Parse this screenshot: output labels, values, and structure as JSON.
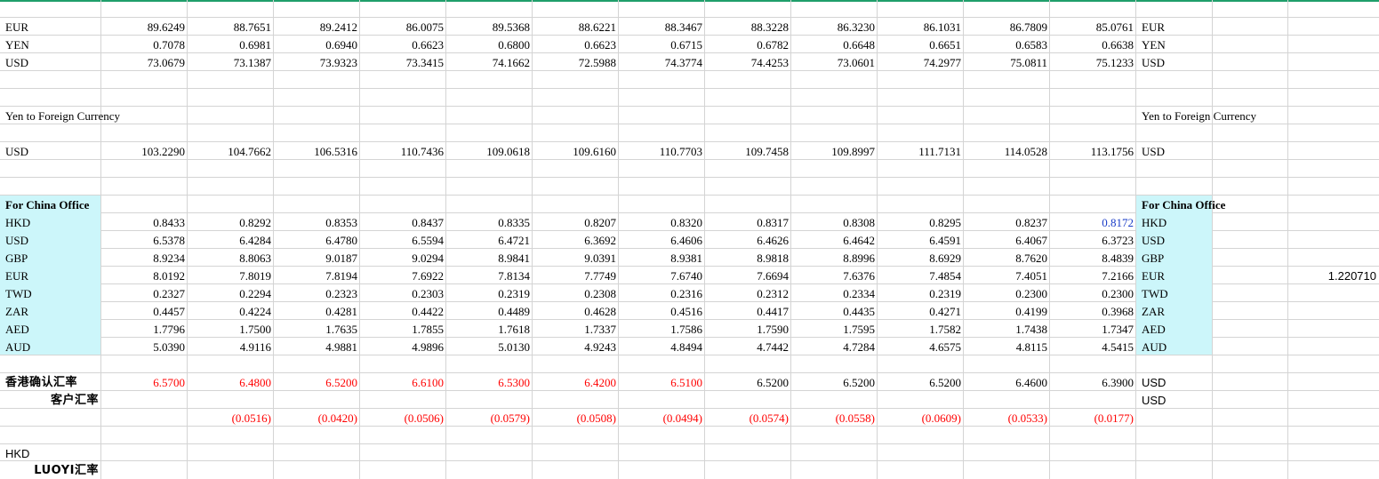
{
  "sheet": {
    "fx_section": {
      "rows": [
        {
          "label": "EUR",
          "values": [
            "89.6249",
            "88.7651",
            "89.2412",
            "86.0075",
            "89.5368",
            "88.6221",
            "88.3467",
            "88.3228",
            "86.3230",
            "86.1031",
            "86.7809",
            "85.0761"
          ],
          "right_label": "EUR"
        },
        {
          "label": "YEN",
          "values": [
            "0.7078",
            "0.6981",
            "0.6940",
            "0.6623",
            "0.6800",
            "0.6623",
            "0.6715",
            "0.6782",
            "0.6648",
            "0.6651",
            "0.6583",
            "0.6638"
          ],
          "right_label": "YEN"
        },
        {
          "label": "USD",
          "values": [
            "73.0679",
            "73.1387",
            "73.9323",
            "73.3415",
            "74.1662",
            "72.5988",
            "74.3774",
            "74.4253",
            "73.0601",
            "74.2977",
            "75.0811",
            "75.1233"
          ],
          "right_label": "USD"
        }
      ]
    },
    "yen_section": {
      "title": "Yen to Foreign Currency",
      "title_right": "Yen to Foreign Currency",
      "rows": [
        {
          "label": "USD",
          "values": [
            "103.2290",
            "104.7662",
            "106.5316",
            "110.7436",
            "109.0618",
            "109.6160",
            "110.7703",
            "109.7458",
            "109.8997",
            "111.7131",
            "114.0528",
            "113.1756"
          ],
          "right_label": "USD"
        }
      ]
    },
    "china_section": {
      "title": "For China Office",
      "title_right": "For China Office",
      "rows": [
        {
          "label": "HKD",
          "values": [
            "0.8433",
            "0.8292",
            "0.8353",
            "0.8437",
            "0.8335",
            "0.8207",
            "0.8320",
            "0.8317",
            "0.8308",
            "0.8295",
            "0.8237",
            "0.8172"
          ],
          "right_label": "HKD"
        },
        {
          "label": "USD",
          "values": [
            "6.5378",
            "6.4284",
            "6.4780",
            "6.5594",
            "6.4721",
            "6.3692",
            "6.4606",
            "6.4626",
            "6.4642",
            "6.4591",
            "6.4067",
            "6.3723"
          ],
          "right_label": "USD"
        },
        {
          "label": "GBP",
          "values": [
            "8.9234",
            "8.8063",
            "9.0187",
            "9.0294",
            "8.9841",
            "9.0391",
            "8.9381",
            "8.9818",
            "8.8996",
            "8.6929",
            "8.7620",
            "8.4839"
          ],
          "right_label": "GBP"
        },
        {
          "label": "EUR",
          "values": [
            "8.0192",
            "7.8019",
            "7.8194",
            "7.6922",
            "7.8134",
            "7.7749",
            "7.6740",
            "7.6694",
            "7.6376",
            "7.4854",
            "7.4051",
            "7.2166"
          ],
          "right_label": "EUR"
        },
        {
          "label": "TWD",
          "values": [
            "0.2327",
            "0.2294",
            "0.2323",
            "0.2303",
            "0.2319",
            "0.2308",
            "0.2316",
            "0.2312",
            "0.2334",
            "0.2319",
            "0.2300",
            "0.2300"
          ],
          "right_label": "TWD"
        },
        {
          "label": "ZAR",
          "values": [
            "0.4457",
            "0.4224",
            "0.4281",
            "0.4422",
            "0.4489",
            "0.4628",
            "0.4516",
            "0.4417",
            "0.4435",
            "0.4271",
            "0.4199",
            "0.3968"
          ],
          "right_label": "ZAR"
        },
        {
          "label": "AED",
          "values": [
            "1.7796",
            "1.7500",
            "1.7635",
            "1.7855",
            "1.7618",
            "1.7337",
            "1.7586",
            "1.7590",
            "1.7595",
            "1.7582",
            "1.7438",
            "1.7347"
          ],
          "right_label": "AED"
        },
        {
          "label": "AUD",
          "values": [
            "5.0390",
            "4.9116",
            "4.9881",
            "4.9896",
            "5.0130",
            "4.9243",
            "4.8494",
            "4.7442",
            "4.7284",
            "4.6575",
            "4.8115",
            "4.5415"
          ],
          "right_label": "AUD"
        }
      ],
      "side_value": "1.220710"
    },
    "hk_section": {
      "confirm_label": "香港确认汇率",
      "confirm_values": [
        "6.5700",
        "6.4800",
        "6.5200",
        "6.6100",
        "6.5300",
        "6.4200",
        "6.5100",
        "6.5200",
        "6.5200",
        "6.5200",
        "6.4600",
        "6.3900"
      ],
      "confirm_right_label": "USD",
      "customer_label": "客户汇率",
      "customer_right_label": "USD",
      "diff_values": [
        "(0.0516)",
        "(0.0420)",
        "(0.0506)",
        "(0.0579)",
        "(0.0508)",
        "(0.0494)",
        "(0.0574)",
        "(0.0558)",
        "(0.0609)",
        "(0.0533)",
        "(0.0177)"
      ]
    },
    "bottom": {
      "hkd_label": "HKD",
      "luoyi_label": "LUOYI汇率"
    },
    "colors": {
      "highlight_fill": "#ccf6fa",
      "negative_red": "#ff0000",
      "link_blue": "#1a3cc8",
      "grid_line": "#d4d4d4",
      "top_accent": "#1f9e6b"
    }
  }
}
